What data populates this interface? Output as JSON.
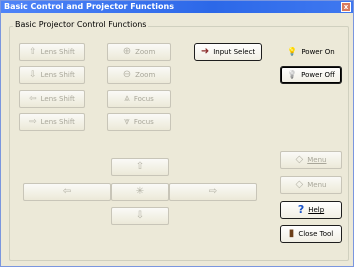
{
  "window": {
    "title": "Basic Control and Projector Functions",
    "close_glyph": "x"
  },
  "group": {
    "label": "Basic Projector Control Functions"
  },
  "lens_buttons": [
    {
      "label": "Lens Shift",
      "icon": "lens-shift-up-icon",
      "glyph": "⇧"
    },
    {
      "label": "Lens Shift",
      "icon": "lens-shift-down-icon",
      "glyph": "⇩"
    },
    {
      "label": "Lens Shift",
      "icon": "lens-shift-left-icon",
      "glyph": "⇦"
    },
    {
      "label": "Lens Shift",
      "icon": "lens-shift-right-icon",
      "glyph": "⇨"
    }
  ],
  "zoom_focus_buttons": [
    {
      "label": "Zoom",
      "icon": "zoom-in-icon",
      "glyph": "⊕"
    },
    {
      "label": "Zoom",
      "icon": "zoom-out-icon",
      "glyph": "⊖"
    },
    {
      "label": "Focus",
      "icon": "focus-near-icon",
      "glyph": "⩓"
    },
    {
      "label": "Focus",
      "icon": "focus-far-icon",
      "glyph": "⩔"
    }
  ],
  "input_select": {
    "label": "Input Select",
    "icon": "input-select-icon",
    "glyph": "➜"
  },
  "power_on": {
    "label": "Power On",
    "icon": "bulb-on-icon",
    "glyph": "💡"
  },
  "power_off": {
    "label": "Power Off",
    "icon": "bulb-off-icon",
    "glyph": "💡"
  },
  "nav": {
    "up": "⇧",
    "down": "⇩",
    "left": "⇦",
    "right": "⇨",
    "center": "✳"
  },
  "menu_up": {
    "label": "Menu",
    "glyph": "◇"
  },
  "menu_down": {
    "label": "Menu",
    "glyph": "◇"
  },
  "help": {
    "label": "Help",
    "glyph": "?"
  },
  "close_tool": {
    "label": "Close Tool",
    "glyph": "▮"
  },
  "colors": {
    "title_bar": "#2c68e8",
    "accent_help": "#1a52c8",
    "power_on_bulb": "#e0a800"
  }
}
